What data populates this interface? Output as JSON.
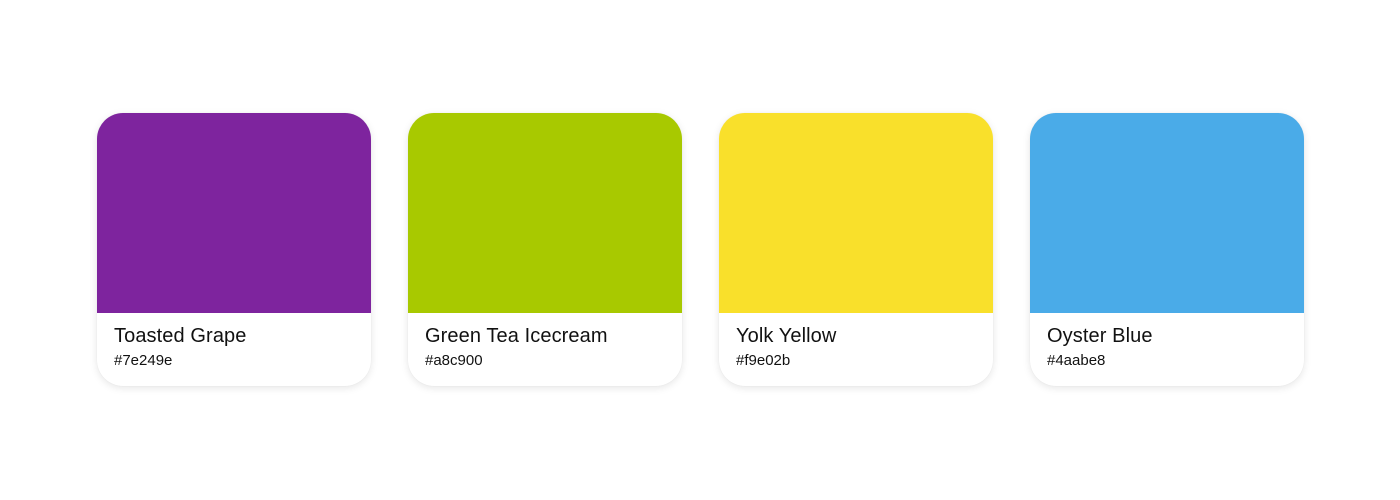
{
  "palette": {
    "swatches": [
      {
        "name": "Toasted Grape",
        "hex": "#7e249e",
        "color": "#7e249e"
      },
      {
        "name": "Green Tea Icecream",
        "hex": "#a8c900",
        "color": "#a8c900"
      },
      {
        "name": "Yolk Yellow",
        "hex": "#f9e02b",
        "color": "#f9e02b"
      },
      {
        "name": "Oyster Blue",
        "hex": "#4aabe8",
        "color": "#4aabe8"
      }
    ]
  }
}
